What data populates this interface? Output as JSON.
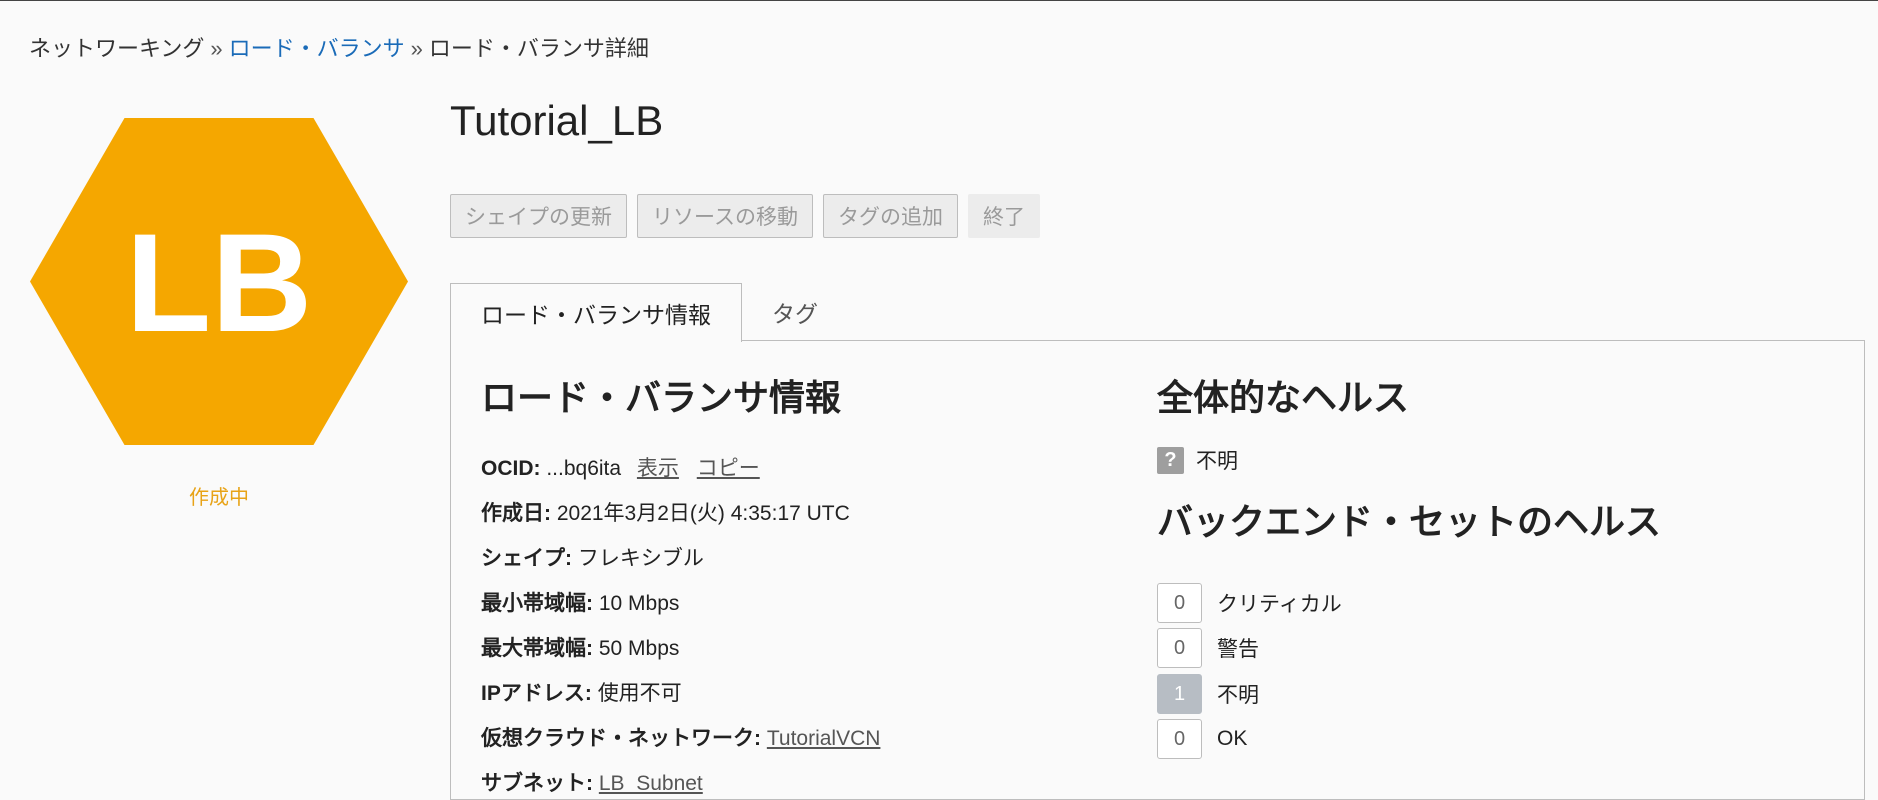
{
  "breadcrumb": {
    "item1": "ネットワーキング",
    "separator": "»",
    "item2": "ロード・バランサ",
    "item3": "ロード・バランサ詳細"
  },
  "resource": {
    "icon_text": "LB",
    "status": "作成中",
    "title": "Tutorial_LB",
    "icon_color": "#f5a700",
    "status_color": "#e8a317"
  },
  "actions": {
    "update_shape": "シェイプの更新",
    "move_resource": "リソースの移動",
    "add_tags": "タグの追加",
    "terminate": "終了"
  },
  "tabs": {
    "info": "ロード・バランサ情報",
    "tags": "タグ"
  },
  "info": {
    "heading": "ロード・バランサ情報",
    "ocid_label": "OCID:",
    "ocid_value": "...bq6ita",
    "ocid_show": "表示",
    "ocid_copy": "コピー",
    "created_label": "作成日:",
    "created_value": "2021年3月2日(火) 4:35:17 UTC",
    "shape_label": "シェイプ:",
    "shape_value": "フレキシブル",
    "min_bw_label": "最小帯域幅:",
    "min_bw_value": "10 Mbps",
    "max_bw_label": "最大帯域幅:",
    "max_bw_value": "50 Mbps",
    "ip_label": "IPアドレス:",
    "ip_value": "使用不可",
    "vcn_label": "仮想クラウド・ネットワーク:",
    "vcn_value": "TutorialVCN",
    "subnet_label": "サブネット:",
    "subnet_value": "LB_Subnet"
  },
  "health": {
    "overall_heading": "全体的なヘルス",
    "overall_icon": "?",
    "overall_value": "不明",
    "backend_heading": "バックエンド・セットのヘルス",
    "critical_count": "0",
    "critical_label": "クリティカル",
    "warning_count": "0",
    "warning_label": "警告",
    "unknown_count": "1",
    "unknown_label": "不明",
    "ok_count": "0",
    "ok_label": "OK"
  }
}
